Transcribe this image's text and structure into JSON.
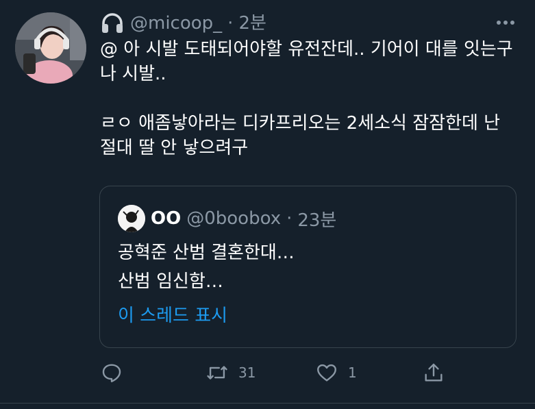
{
  "tweet": {
    "handle": "@micoop_",
    "separator": "·",
    "time": "2분",
    "body_lines": [
      "@ 아 시발 도태되어야할 유전잔데.. 기어이 대를 잇는구나 시발..",
      "",
      "ㄹㅇ 애좀낳아라는 디카프리오는 2세소식 잠잠한데 난 절대 딸 안 낳으려구"
    ],
    "icons": {
      "name_emoji": "headphones-icon",
      "more": "more-icon"
    }
  },
  "quote": {
    "name": "OO",
    "handle": "@0boobox",
    "separator": "·",
    "time": "23분",
    "lines": [
      "공혁준 산범 결혼한대…",
      "산범 임신함…"
    ],
    "show_thread": "이 스레드 표시"
  },
  "actions": {
    "reply": {
      "icon": "reply-icon",
      "count": ""
    },
    "retweet": {
      "icon": "retweet-icon",
      "count": "31"
    },
    "like": {
      "icon": "heart-icon",
      "count": "1"
    },
    "share": {
      "icon": "share-icon",
      "count": ""
    }
  },
  "colors": {
    "background": "#15202b",
    "text": "#ffffff",
    "muted": "#8b98a5",
    "link": "#1d9bf0",
    "border": "#38444d"
  }
}
